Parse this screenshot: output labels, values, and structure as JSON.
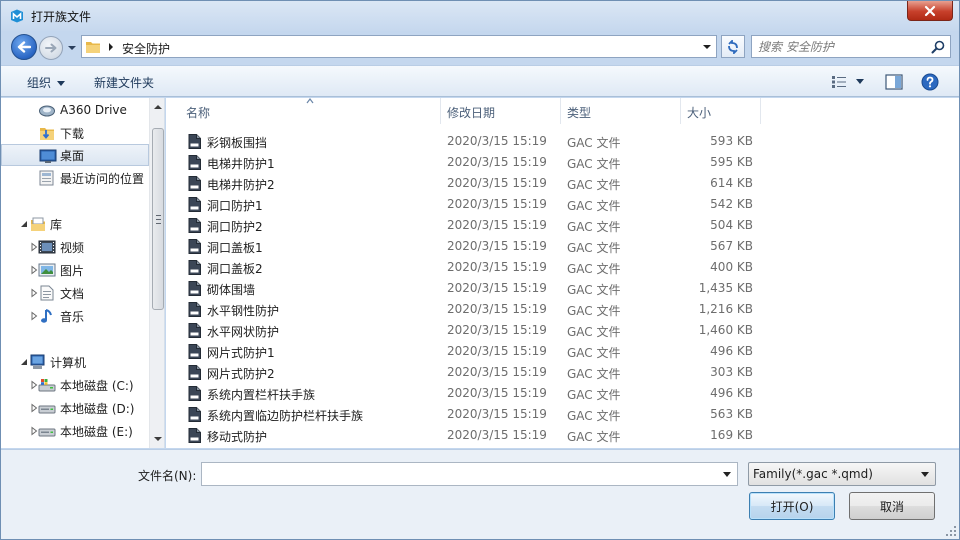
{
  "window": {
    "title": "打开族文件",
    "colors": {
      "title_bg": "#c6d8ee",
      "accent": "#2a66c4",
      "close": "#c7402b"
    }
  },
  "address": {
    "path": "安全防护",
    "search_placeholder": "搜索 安全防护"
  },
  "toolbar": {
    "organize_label": "组织",
    "new_folder_label": "新建文件夹"
  },
  "sidebar": {
    "items": [
      {
        "label": "A360 Drive",
        "icon": "cloud-drive-icon"
      },
      {
        "label": "下载",
        "icon": "downloads-folder-icon"
      },
      {
        "label": "桌面",
        "icon": "desktop-icon"
      },
      {
        "label": "最近访问的位置",
        "icon": "recent-places-icon"
      },
      {
        "label": "库",
        "icon": "libraries-icon"
      },
      {
        "label": "视频",
        "icon": "videos-icon"
      },
      {
        "label": "图片",
        "icon": "pictures-icon"
      },
      {
        "label": "文档",
        "icon": "documents-icon"
      },
      {
        "label": "音乐",
        "icon": "music-icon"
      },
      {
        "label": "计算机",
        "icon": "computer-icon"
      },
      {
        "label": "本地磁盘 (C:)",
        "icon": "drive-c-icon"
      },
      {
        "label": "本地磁盘 (D:)",
        "icon": "drive-icon"
      },
      {
        "label": "本地磁盘 (E:)",
        "icon": "drive-icon"
      }
    ]
  },
  "files": {
    "columns": {
      "name": "名称",
      "date": "修改日期",
      "type": "类型",
      "size": "大小"
    },
    "rows": [
      {
        "name": "彩钢板围挡",
        "date": "2020/3/15 15:19",
        "type": "GAC 文件",
        "size": "593 KB"
      },
      {
        "name": "电梯井防护1",
        "date": "2020/3/15 15:19",
        "type": "GAC 文件",
        "size": "595 KB"
      },
      {
        "name": "电梯井防护2",
        "date": "2020/3/15 15:19",
        "type": "GAC 文件",
        "size": "614 KB"
      },
      {
        "name": "洞口防护1",
        "date": "2020/3/15 15:19",
        "type": "GAC 文件",
        "size": "542 KB"
      },
      {
        "name": "洞口防护2",
        "date": "2020/3/15 15:19",
        "type": "GAC 文件",
        "size": "504 KB"
      },
      {
        "name": "洞口盖板1",
        "date": "2020/3/15 15:19",
        "type": "GAC 文件",
        "size": "567 KB"
      },
      {
        "name": "洞口盖板2",
        "date": "2020/3/15 15:19",
        "type": "GAC 文件",
        "size": "400 KB"
      },
      {
        "name": "砌体围墙",
        "date": "2020/3/15 15:19",
        "type": "GAC 文件",
        "size": "1,435 KB"
      },
      {
        "name": "水平钢性防护",
        "date": "2020/3/15 15:19",
        "type": "GAC 文件",
        "size": "1,216 KB"
      },
      {
        "name": "水平网状防护",
        "date": "2020/3/15 15:19",
        "type": "GAC 文件",
        "size": "1,460 KB"
      },
      {
        "name": "网片式防护1",
        "date": "2020/3/15 15:19",
        "type": "GAC 文件",
        "size": "496 KB"
      },
      {
        "name": "网片式防护2",
        "date": "2020/3/15 15:19",
        "type": "GAC 文件",
        "size": "303 KB"
      },
      {
        "name": "系统内置栏杆扶手族",
        "date": "2020/3/15 15:19",
        "type": "GAC 文件",
        "size": "496 KB"
      },
      {
        "name": "系统内置临边防护栏杆扶手族",
        "date": "2020/3/15 15:19",
        "type": "GAC 文件",
        "size": "563 KB"
      },
      {
        "name": "移动式防护",
        "date": "2020/3/15 15:19",
        "type": "GAC 文件",
        "size": "169 KB"
      }
    ]
  },
  "bottom": {
    "filename_label": "文件名(N):",
    "filename_value": "",
    "filter_value": "Family(*.gac *.qmd)",
    "open_label": "打开(O)",
    "cancel_label": "取消"
  }
}
